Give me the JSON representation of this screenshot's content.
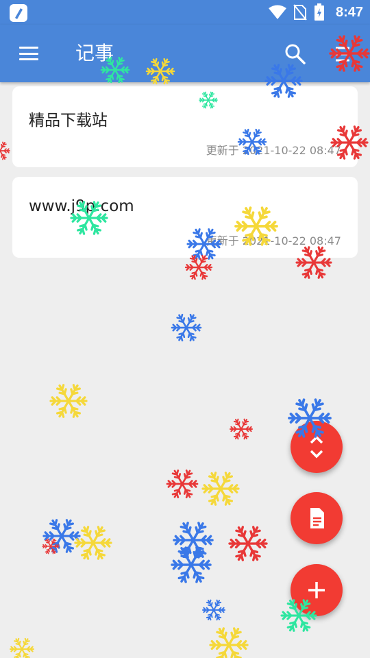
{
  "status_bar": {
    "time": "8:47",
    "icons": [
      "app-notification-icon",
      "wifi-icon",
      "no-sim-icon",
      "battery-icon"
    ]
  },
  "app_bar": {
    "title": "记事",
    "icons": [
      "menu-icon",
      "search-icon",
      "overflow-icon"
    ]
  },
  "notes": [
    {
      "title": "精品下载站",
      "updated": "更新于 2021-10-22 08:47"
    },
    {
      "title": "www.j9p.com",
      "updated": "更新于 2021-10-22 08:47"
    }
  ],
  "fabs": [
    "expand-collapse-icon",
    "document-icon",
    "add-icon"
  ],
  "colors": {
    "primary": "#4a86d9",
    "fab": "#f23b33",
    "background": "#eeeeee",
    "snow": [
      "#3a78e8",
      "#e83838",
      "#f5d83a",
      "#2ee6a0"
    ]
  }
}
